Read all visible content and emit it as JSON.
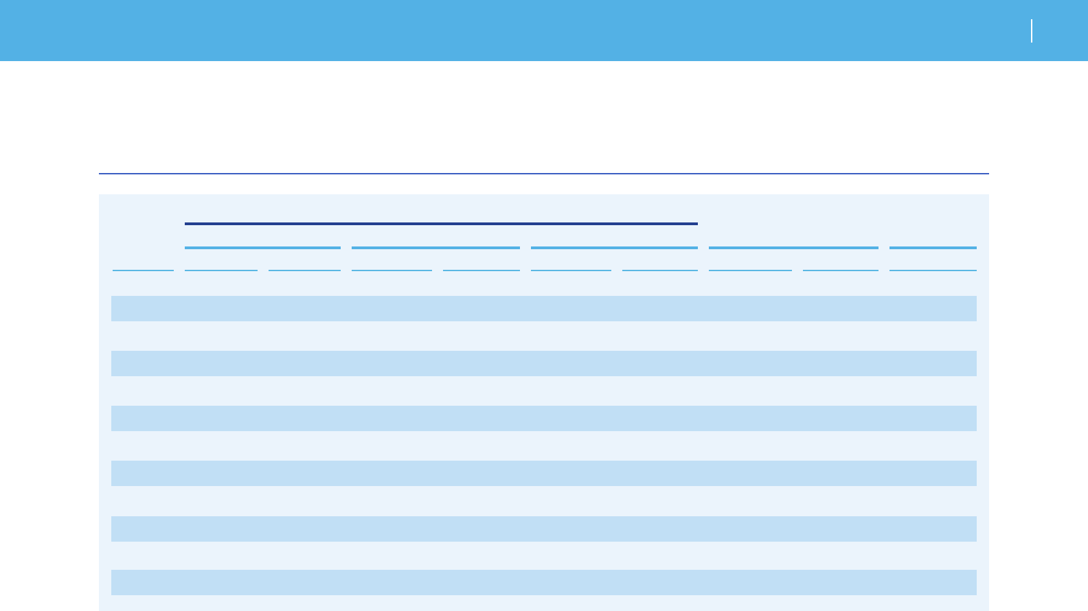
{
  "colors": {
    "header": "#53b1e5",
    "title_rule": "#3c5fc2",
    "panel": "#ebf4fc",
    "group_rule": "#233f8f",
    "subgroup_rule": "#53b1e5",
    "column_rule": "#5bb8e3",
    "row_band": "#c1dff5"
  },
  "table": {
    "group_rules": 1,
    "subgroup_rules": 5,
    "column_rules": 10,
    "shaded_rows": 6
  }
}
